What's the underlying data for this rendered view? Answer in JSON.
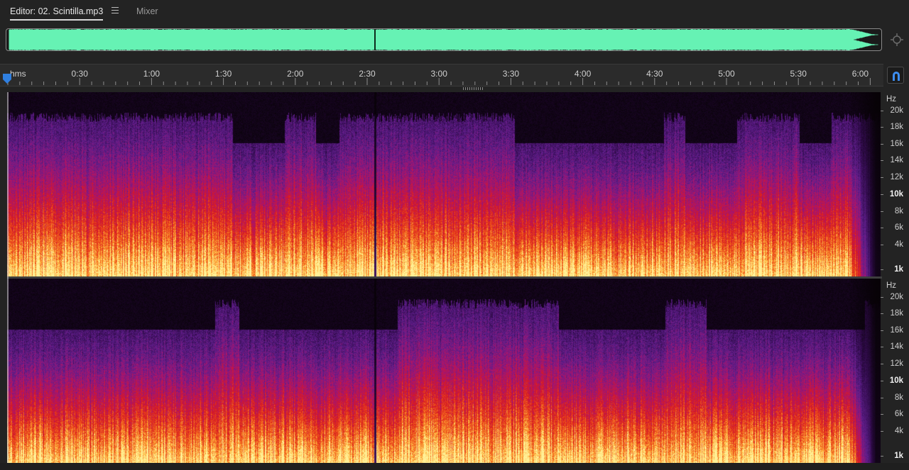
{
  "tabs": {
    "editor_label": "Editor: 02. Scintilla.mp3",
    "mixer_label": "Mixer"
  },
  "ruler": {
    "units": "hms",
    "ticks": [
      "0:30",
      "1:00",
      "1:30",
      "2:00",
      "2:30",
      "3:00",
      "3:30",
      "4:00",
      "4:30",
      "5:00",
      "5:30",
      "6:00"
    ]
  },
  "frequency_scale": {
    "unit": "Hz",
    "labels": [
      "20k",
      "18k",
      "16k",
      "14k",
      "12k",
      "10k",
      "8k",
      "6k",
      "4k",
      "1k"
    ],
    "bold_labels": [
      "10k",
      "1k"
    ]
  },
  "colors": {
    "waveform": "#66f2b4",
    "accent": "#2f7fe0",
    "spectral_low": "#ffe88a",
    "spectral_mid": "#e0241c",
    "spectral_high": "#5a1f8c",
    "background": "#232323"
  },
  "icons": {
    "tab_menu": "hamburger-menu-icon",
    "zoom": "zoom-navigator-icon",
    "snap": "magnet-icon",
    "playhead": "playhead-marker-icon"
  }
}
